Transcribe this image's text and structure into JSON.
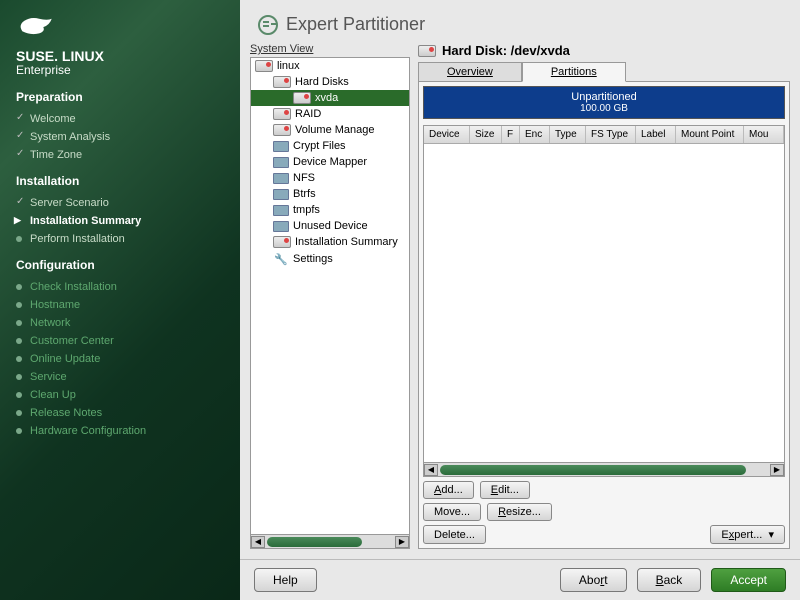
{
  "brand": {
    "name": "SUSE. LINUX",
    "edition": "Enterprise"
  },
  "nav": {
    "preparation": {
      "header": "Preparation",
      "items": [
        "Welcome",
        "System Analysis",
        "Time Zone"
      ]
    },
    "installation": {
      "header": "Installation",
      "items": [
        "Server Scenario",
        "Installation Summary",
        "Perform Installation"
      ]
    },
    "configuration": {
      "header": "Configuration",
      "items": [
        "Check Installation",
        "Hostname",
        "Network",
        "Customer Center",
        "Online Update",
        "Service",
        "Clean Up",
        "Release Notes",
        "Hardware Configuration"
      ]
    }
  },
  "title": "Expert Partitioner",
  "tree": {
    "label": "System View",
    "root": "linux",
    "hard_disks": "Hard Disks",
    "disk": "xvda",
    "items": [
      "RAID",
      "Volume Manage",
      "Crypt Files",
      "Device Mapper",
      "NFS",
      "Btrfs",
      "tmpfs",
      "Unused Device"
    ],
    "summary": "Installation Summary",
    "settings": "Settings"
  },
  "disk": {
    "label": "Hard Disk: /dev/xvda",
    "tabs": {
      "overview": "Overview",
      "partitions": "Partitions"
    },
    "unpart": {
      "label": "Unpartitioned",
      "size": "100.00 GB"
    },
    "columns": [
      "Device",
      "Size",
      "F",
      "Enc",
      "Type",
      "FS Type",
      "Label",
      "Mount Point",
      "Mou"
    ]
  },
  "buttons": {
    "add": "Add...",
    "edit": "Edit...",
    "move": "Move...",
    "resize": "Resize...",
    "delete": "Delete...",
    "expert": "Expert...",
    "help": "Help",
    "abort": "Abort",
    "back": "Back",
    "accept": "Accept"
  }
}
